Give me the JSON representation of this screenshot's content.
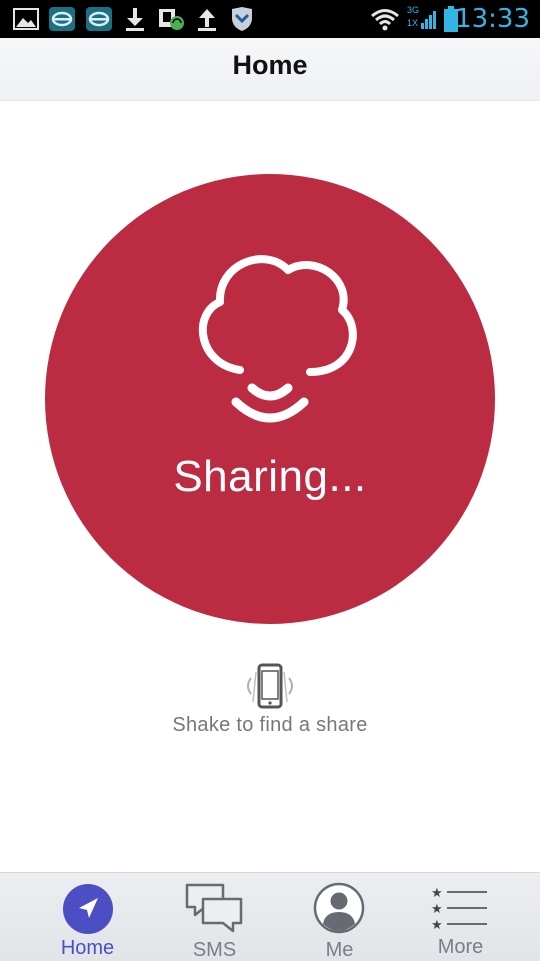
{
  "status_bar": {
    "time": "13:33",
    "icons": [
      "gallery-icon",
      "app-icon",
      "app-icon",
      "download-icon",
      "sync-icon",
      "upload-icon",
      "shield-icon",
      "wifi-icon",
      "signal-icon",
      "battery-icon"
    ],
    "network_top": "3G",
    "network_bottom": "1X"
  },
  "header": {
    "title": "Home"
  },
  "main": {
    "status_text": "Sharing...",
    "circle_color": "#bb2b42",
    "shake_hint": "Shake to find a share"
  },
  "nav": {
    "active_color": "#4b4fc3",
    "items": [
      {
        "label": "Home",
        "icon": "navigation-arrow-icon",
        "active": true
      },
      {
        "label": "SMS",
        "icon": "chat-bubbles-icon",
        "active": false
      },
      {
        "label": "Me",
        "icon": "user-avatar-icon",
        "active": false
      },
      {
        "label": "More",
        "icon": "star-list-icon",
        "active": false
      }
    ]
  }
}
